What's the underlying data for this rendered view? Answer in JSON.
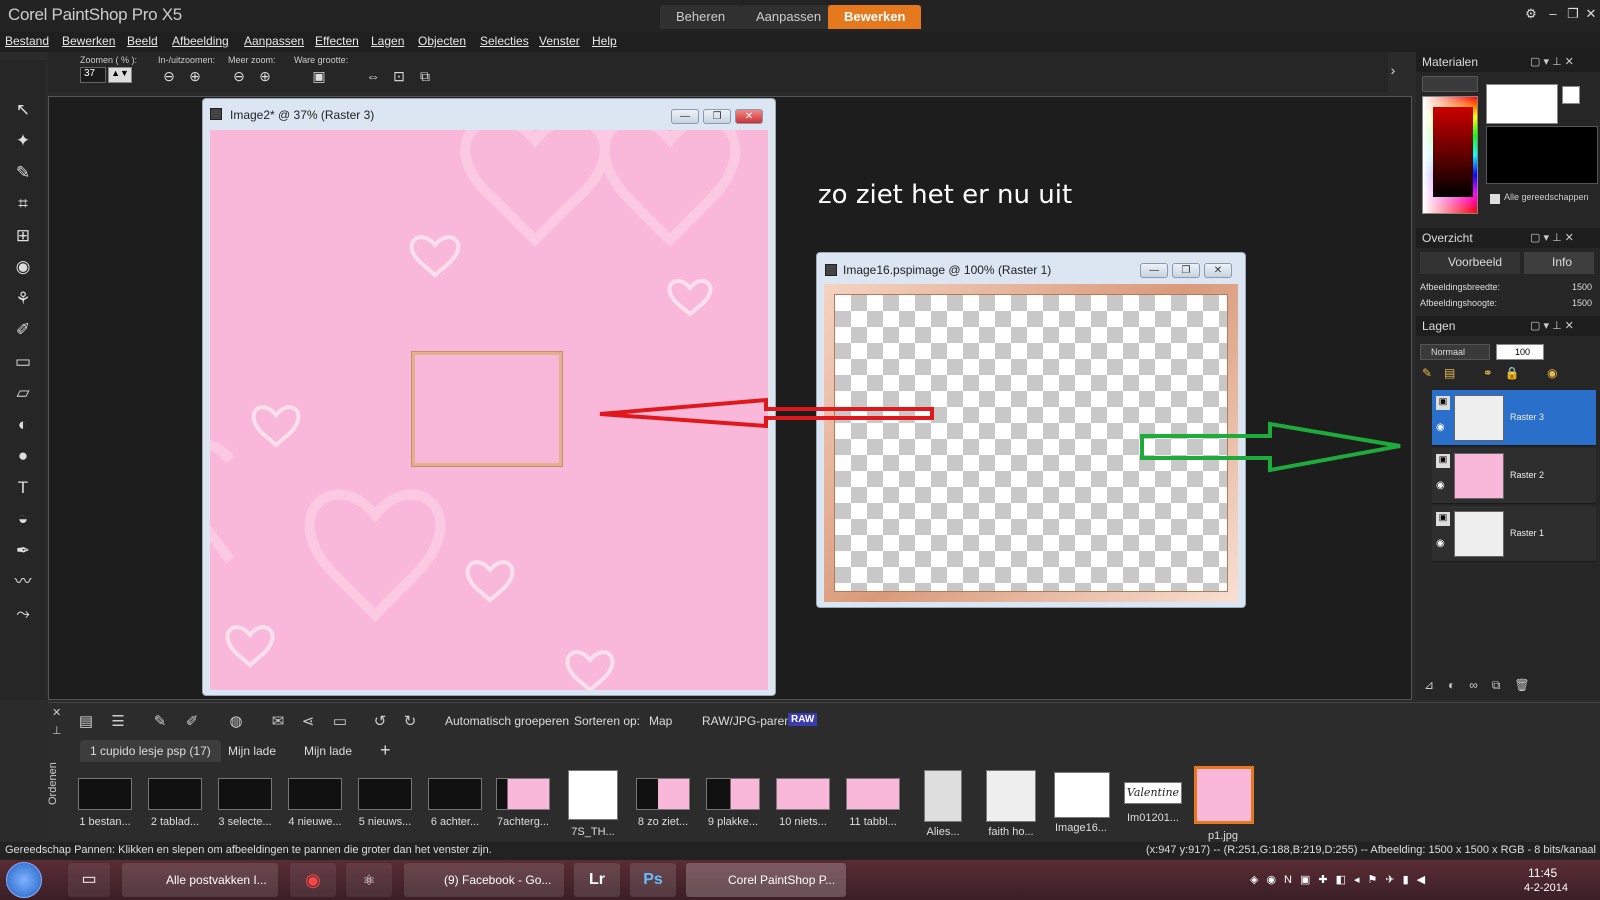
{
  "app": {
    "title": "Corel PaintShop Pro X5"
  },
  "workspace_tabs": [
    {
      "label": "Beheren"
    },
    {
      "label": "Aanpassen"
    },
    {
      "label": "Bewerken"
    }
  ],
  "menu": [
    "Bestand",
    "Bewerken",
    "Beeld",
    "Afbeelding",
    "Aanpassen",
    "Effecten",
    "Lagen",
    "Objecten",
    "Selecties",
    "Venster",
    "Help"
  ],
  "toolbar": {
    "zoom_label": "Zoomen ( % ):",
    "zoom_value": "37",
    "inout_label": "In-/uitzoomen:",
    "more_label": "Meer zoom:",
    "actual_label": "Ware grootte:"
  },
  "doc1": {
    "title": "Image2* @  37% (Raster 3)"
  },
  "doc2": {
    "title": "Image16.pspimage @ 100% (Raster 1)"
  },
  "annotation": "zo ziet het er nu uit",
  "panels": {
    "materials": {
      "title": "Materialen",
      "all_tools": "Alle gereedschappen"
    },
    "overview": {
      "title": "Overzicht",
      "tab_preview": "Voorbeeld",
      "tab_info": "Info",
      "rows": [
        {
          "label": "Afbeeldingsbreedte:",
          "value": "1500"
        },
        {
          "label": "Afbeeldingshoogte:",
          "value": "1500"
        }
      ]
    },
    "layers": {
      "title": "Lagen",
      "blend_mode": "Normaal",
      "opacity": "100",
      "items": [
        {
          "name": "Raster 3",
          "selected": true
        },
        {
          "name": "Raster 2",
          "selected": false
        },
        {
          "name": "Raster 1",
          "selected": false
        }
      ]
    }
  },
  "organizer": {
    "auto_group": "Automatisch groeperen",
    "sort_label": "Sorteren op:",
    "sort_value": "Map",
    "raw_label": "RAW/JPG-paren:",
    "raw_badge": "RAW",
    "side_label": "Ordenen",
    "tabs": [
      "1 cupido lesje psp (17)",
      "Mijn lade",
      "Mijn lade"
    ],
    "thumbs": [
      "1 bestan...",
      "2 tablad...",
      "3 selecte...",
      "4 nieuwe...",
      "5 nieuws...",
      "6 achter...",
      "7achterg...",
      "7S_TH...",
      "8 zo ziet...",
      "9 plakke...",
      "10 niets...",
      "11 tabbl...",
      "Alies...",
      "faith ho...",
      "Image16...",
      "Im01201...",
      "p1.jpg"
    ],
    "valentine_text": "Valentine"
  },
  "status": {
    "left": "Gereedschap Pannen: Klikken en slepen om afbeeldingen te pannen die groter dan het venster zijn.",
    "right": "(x:947 y:917) -- (R:251,G:188,B:219,D:255) -- Afbeelding:  1500 x 1500 x RGB - 8 bits/kanaal"
  },
  "taskbar": {
    "items": [
      "Alle postvakken I...",
      "(9) Facebook - Go...",
      "Lr",
      "Ps",
      "Corel PaintShop P..."
    ],
    "time": "11:45",
    "date": "4-2-2014"
  },
  "colors": {
    "accent": "#e6781e",
    "selected_layer": "#2a6fc9",
    "pink": "#f9b8da",
    "red_arrow": "#e0181c",
    "green_arrow": "#1faa3c"
  }
}
